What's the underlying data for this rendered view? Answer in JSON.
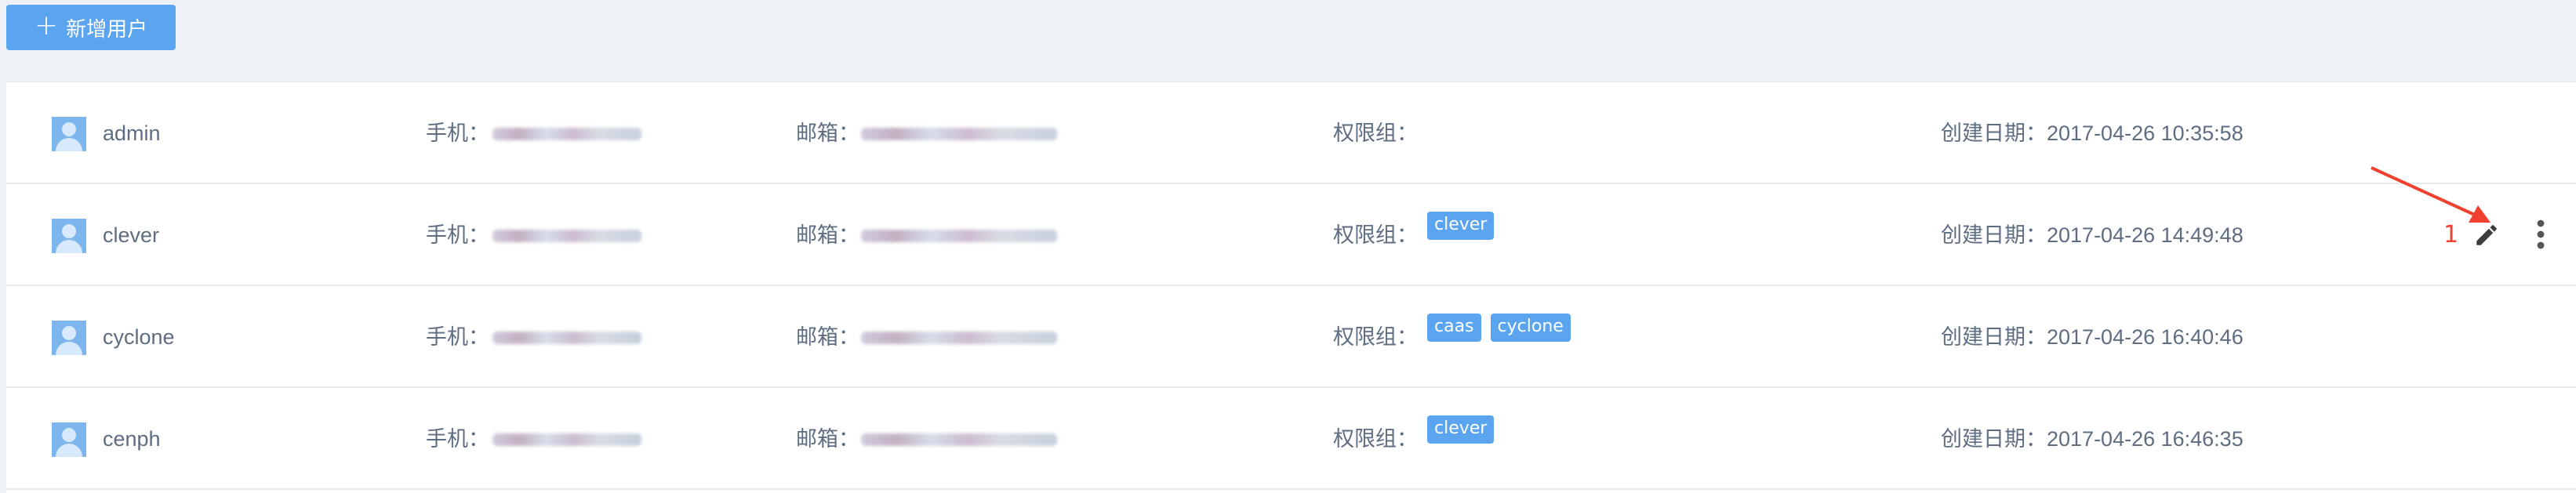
{
  "toolbar": {
    "add_user_label": "新增用户"
  },
  "labels": {
    "phone": "手机：",
    "email": "邮箱：",
    "permission": "权限组：",
    "created": "创建日期："
  },
  "users": [
    {
      "name": "admin",
      "created": "2017-04-26 10:35:58",
      "tags": []
    },
    {
      "name": "clever",
      "created": "2017-04-26 14:49:48",
      "tags": [
        "clever"
      ]
    },
    {
      "name": "cyclone",
      "created": "2017-04-26 16:40:46",
      "tags": [
        "caas",
        "cyclone"
      ]
    },
    {
      "name": "cenph",
      "created": "2017-04-26 16:46:35",
      "tags": [
        "clever"
      ]
    }
  ],
  "annotation": {
    "marker": "1"
  },
  "icons": {
    "add": "plus-icon",
    "avatar": "user-avatar-icon",
    "edit": "pencil-edit-icon",
    "more": "more-vertical-icon"
  },
  "colors": {
    "accent": "#5aa4f0",
    "annotation": "#f04030",
    "background": "#eef1f6"
  }
}
